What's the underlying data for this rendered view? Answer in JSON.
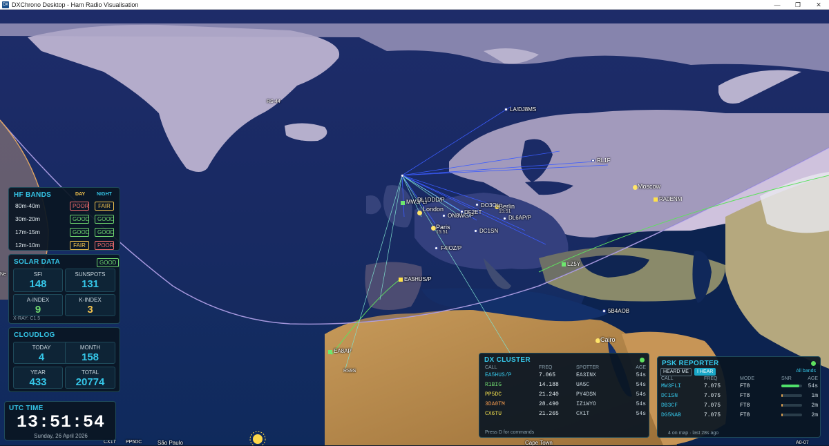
{
  "window": {
    "title": "DXChrono Desktop - Ham Radio Visualisation",
    "icon_text": "DX"
  },
  "map": {
    "cities": [
      "London",
      "Paris",
      "Berlin",
      "Moscow",
      "Cairo",
      "São Paulo",
      "Cape Town"
    ],
    "city_times": {
      "paris": "15:51",
      "berlin": "15:51"
    },
    "spots": [
      "MW3FLI",
      "DL1DDD/P",
      "ON8WG/P",
      "DF2ET",
      "DO3OL",
      "DL6AP/P",
      "DC1SN",
      "F4IOZ/P",
      "EA5HUS/P",
      "LZ5Y",
      "RL1F",
      "LA/DJ8MS",
      "RA0ENM",
      "5B4AOB",
      "EA8AP",
      "RS9S",
      "RS-44",
      "CX1T",
      "PP5DC",
      "A0-07"
    ],
    "edge_label": "Ne"
  },
  "hf_bands": {
    "title": "HF BANDS",
    "day_label": "DAY",
    "night_label": "NIGHT",
    "rows": [
      {
        "band": "80m-40m",
        "day": "POOR",
        "night": "FAIR"
      },
      {
        "band": "30m-20m",
        "day": "GOOD",
        "night": "GOOD"
      },
      {
        "band": "17m-15m",
        "day": "GOOD",
        "night": "GOOD"
      },
      {
        "band": "12m-10m",
        "day": "FAIR",
        "night": "POOR"
      }
    ]
  },
  "solar": {
    "title": "SOLAR DATA",
    "status": "GOOD",
    "sfi_label": "SFI",
    "sfi": "148",
    "sunspots_label": "SUNSPOTS",
    "sunspots": "131",
    "aindex_label": "A-INDEX",
    "aindex": "9",
    "kindex_label": "K-INDEX",
    "kindex": "3",
    "xray": "X-RAY: C1.5"
  },
  "cloudlog": {
    "title": "CLOUDLOG",
    "today_label": "TODAY",
    "today": "4",
    "month_label": "MONTH",
    "month": "158",
    "year_label": "YEAR",
    "year": "433",
    "total_label": "TOTAL",
    "total": "20774"
  },
  "utc": {
    "title": "UTC TIME",
    "time": "13:51:54",
    "date": "Sunday, 26 April 2026"
  },
  "dx_cluster": {
    "title": "DX CLUSTER",
    "headers": [
      "CALL",
      "FREQ",
      "SPOTTER",
      "AGE"
    ],
    "rows": [
      {
        "call": "EA5HUS/P",
        "freq": "7.065",
        "spotter": "EA3INX",
        "age": "54s",
        "color": "#35c6e8"
      },
      {
        "call": "R1BIG",
        "freq": "14.188",
        "spotter": "UA5C",
        "age": "54s",
        "color": "#6fd86f"
      },
      {
        "call": "PP5DC",
        "freq": "21.240",
        "spotter": "PY4DSN",
        "age": "54s",
        "color": "#f3e04e"
      },
      {
        "call": "3DA0TM",
        "freq": "28.490",
        "spotter": "IZ1WYO",
        "age": "54s",
        "color": "#f39a4e"
      },
      {
        "call": "CX6TU",
        "freq": "21.265",
        "spotter": "CX1T",
        "age": "54s",
        "color": "#f3e04e"
      }
    ],
    "footer": "Press D for commands"
  },
  "psk": {
    "title": "PSK REPORTER",
    "tab_heard_me": "HEARD ME",
    "tab_i_hear": "I HEAR",
    "all_bands": "All bands",
    "headers": [
      "CALL",
      "FREQ",
      "MODE",
      "SNR",
      "AGE"
    ],
    "rows": [
      {
        "call": "MW3FLI",
        "freq": "7.075",
        "mode": "FT8",
        "snr": 0.85,
        "snr_color": "#4fe06a",
        "age": "54s"
      },
      {
        "call": "DC1SN",
        "freq": "7.075",
        "mode": "FT8",
        "snr": 0.08,
        "snr_color": "#e0a24f",
        "age": "1m"
      },
      {
        "call": "DB3CF",
        "freq": "7.075",
        "mode": "FT8",
        "snr": 0.08,
        "snr_color": "#e0a24f",
        "age": "2m"
      },
      {
        "call": "DG5NAB",
        "freq": "7.075",
        "mode": "FT8",
        "snr": 0.08,
        "snr_color": "#e0a24f",
        "age": "2m"
      }
    ],
    "footer": "4 on map · last 28s ago"
  }
}
